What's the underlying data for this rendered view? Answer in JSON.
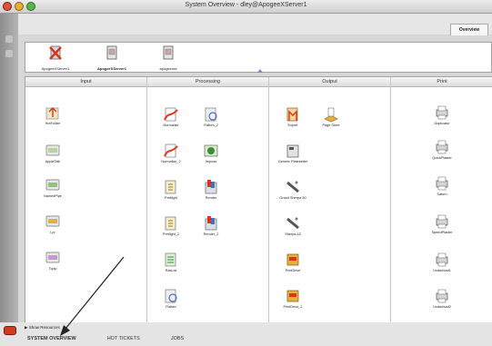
{
  "window": {
    "title": "System Overview - dley@ApogeeXServer1"
  },
  "tabs": {
    "overview": "Overview"
  },
  "servers": [
    {
      "label": "ApogeeXServer1",
      "icon": "server-error-icon",
      "selected": false
    },
    {
      "label": "ApogeeXServer1",
      "icon": "server-icon",
      "selected": true
    },
    {
      "label": "apogeeout",
      "icon": "server-icon",
      "selected": false
    }
  ],
  "columns": {
    "input": {
      "header": "Input",
      "items": [
        "HotFolder",
        "AppleTalk",
        "NamedPipe",
        "Lpr",
        "Tcpip"
      ]
    },
    "processing": {
      "header": "Processing",
      "items": [
        "Normalize",
        "Flatten_2",
        "Normalize_2",
        "Impose",
        "Preflight",
        "Render",
        "Preflight_2",
        "Render_2",
        "RasList",
        "Flatten"
      ]
    },
    "output": {
      "header": "Output",
      "items": [
        "Export",
        "Page Store",
        "Generic Platesetter",
        "Grand Sherpa 50",
        "Sherpa 43",
        "PrintDrive",
        "PrintDrive_2"
      ]
    },
    "print": {
      "header": "Print",
      "items": [
        "Duplicator",
        "QuickPlaster",
        "Saturn",
        "SpeedPlaster",
        "Underlead1",
        "Underlead2"
      ]
    }
  },
  "footer": {
    "show_resources": "Show Resources"
  },
  "bottom_nav": {
    "system_overview": "SYSTEM OVERVIEW",
    "hot_tickets": "HOT TICKETS",
    "jobs": "JOBS"
  },
  "colors": {
    "accent_red": "#d8351f",
    "icon_gold": "#e4b23c"
  }
}
